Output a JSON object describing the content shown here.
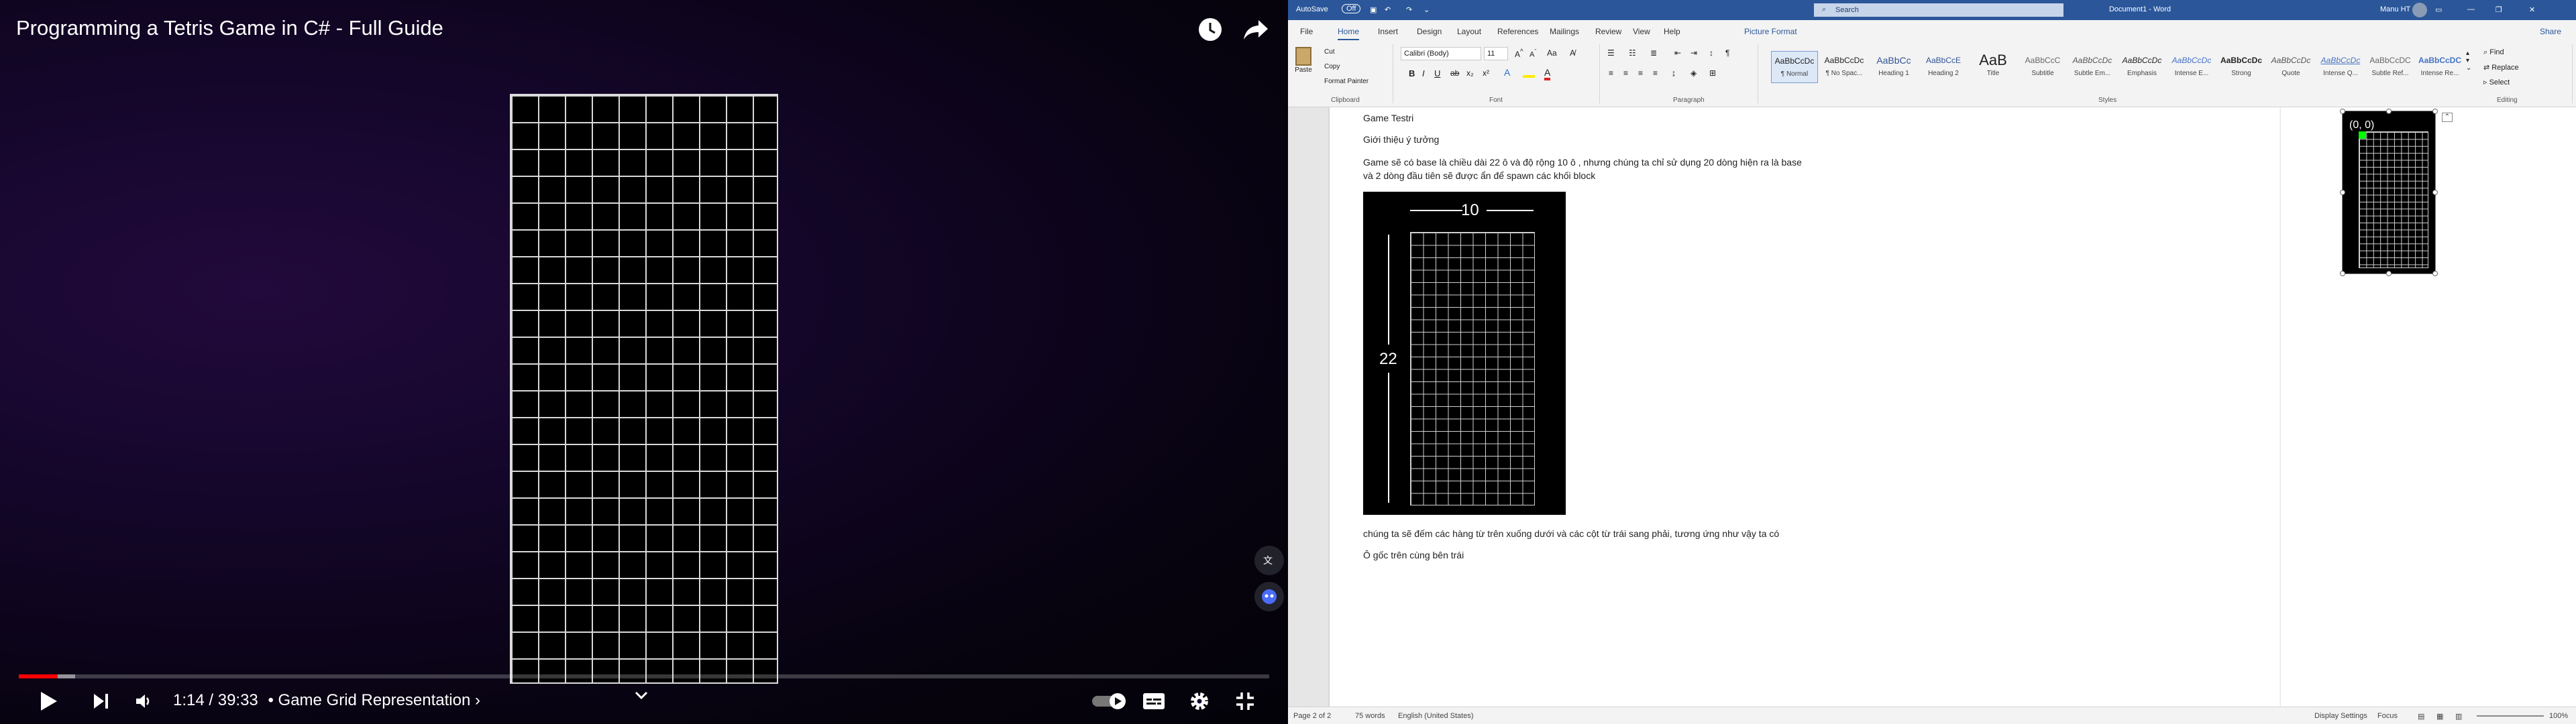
{
  "player": {
    "title": "Programming a Tetris Game in C# - Full Guide",
    "time": "1:14 / 39:33",
    "chapter": "• Game Grid Representation ›",
    "progress": 0.031,
    "buffered": 0.045,
    "icons": [
      "clock-icon",
      "share-icon",
      "play-icon",
      "next-icon",
      "volume-icon",
      "autoplay-toggle",
      "captions-icon",
      "settings-icon",
      "exit-fullscreen-icon",
      "translate-icon",
      "avatar-icon",
      "chevron-down-icon"
    ],
    "colors": {
      "progress": "#ff0000",
      "background": "#14062a"
    }
  },
  "word": {
    "titlebar": {
      "autosave": "AutoSave",
      "autosave_state": "Off",
      "doc_title": "Document1 - Word",
      "search": "Search",
      "user": "Manu HT"
    },
    "tabs": [
      "File",
      "Home",
      "Insert",
      "Design",
      "Layout",
      "References",
      "Mailings",
      "Review",
      "View",
      "Help",
      "Picture Format"
    ],
    "share": "Share",
    "clipboard": {
      "paste": "Paste",
      "cut": "Cut",
      "copy": "Copy",
      "format_painter": "Format Painter",
      "label": "Clipboard"
    },
    "font": {
      "name": "Calibri (Body)",
      "size": "11",
      "label": "Font"
    },
    "paragraph": {
      "label": "Paragraph"
    },
    "styles": {
      "label": "Styles",
      "items": [
        {
          "preview": "AaBbCcDc",
          "name": "¶ Normal"
        },
        {
          "preview": "AaBbCcDc",
          "name": "¶ No Spac..."
        },
        {
          "preview": "AaBbCc",
          "name": "Heading 1"
        },
        {
          "preview": "AaBbCcE",
          "name": "Heading 2"
        },
        {
          "preview": "AaB",
          "name": "Title"
        },
        {
          "preview": "AaBbCcC",
          "name": "Subtitle"
        },
        {
          "preview": "AaBbCcDc",
          "name": "Subtle Em..."
        },
        {
          "preview": "AaBbCcDc",
          "name": "Emphasis"
        },
        {
          "preview": "AaBbCcDc",
          "name": "Intense E..."
        },
        {
          "preview": "AaBbCcDc",
          "name": "Strong"
        },
        {
          "preview": "AaBbCcDc",
          "name": "Quote"
        },
        {
          "preview": "AaBbCcDc",
          "name": "Intense Q..."
        },
        {
          "preview": "AaBbCcDC",
          "name": "Subtle Ref..."
        },
        {
          "preview": "AaBbCcDC",
          "name": "Intense Re..."
        }
      ]
    },
    "editing": {
      "find": "Find",
      "replace": "Replace",
      "select": "Select",
      "label": "Editing"
    },
    "document": {
      "heading": "Game Testri",
      "intro": "Giới thiệu ý tưởng",
      "para1_line1": "Game sẽ có base là chiều dài 22 ô và độ rộng 10 ô , nhưng chúng ta chỉ sử dụng 20 dòng hiện ra là base",
      "para1_line2": "và 2 dòng đầu tiên sẽ được ẩn để spawn các khối block",
      "fig_width_label": "10",
      "fig_height_label": "22",
      "para2": "chúng ta sẽ đếm các hàng từ trên xuống dưới và các cột từ trái sang phải, tương ứng như vậy ta có",
      "para3": "Ô gốc trên cùng bên trái",
      "origin_label": "(0, 0)",
      "origin_color": "#00ff00"
    },
    "status": {
      "page": "Page 2 of 2",
      "words": "75 words",
      "language": "English (United States)",
      "display": "Display Settings",
      "focus": "Focus",
      "zoom": "100%"
    }
  }
}
